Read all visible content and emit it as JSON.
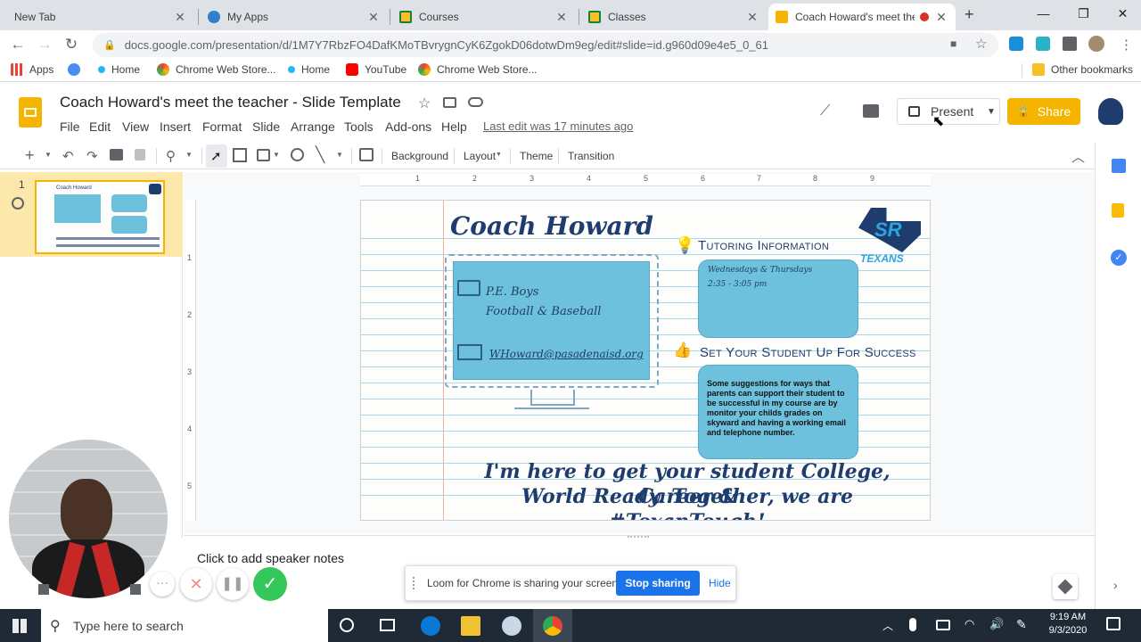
{
  "browser": {
    "tabs": [
      {
        "title": "New Tab",
        "active": false
      },
      {
        "title": "My Apps",
        "active": false
      },
      {
        "title": "Courses",
        "active": false
      },
      {
        "title": "Classes",
        "active": false
      },
      {
        "title": "Coach Howard's meet the",
        "active": true
      }
    ],
    "url": "docs.google.com/presentation/d/1M7Y7RbzFO4DafKMoTBvrygnCyK6ZgokD06dotwDm9eg/edit#slide=id.g960d09e4e5_0_61",
    "bookmarks": [
      "Apps",
      "Home",
      "Chrome Web Store...",
      "Home",
      "YouTube",
      "Chrome Web Store..."
    ],
    "other_bookmarks": "Other bookmarks"
  },
  "doc": {
    "title": "Coach Howard's meet the teacher - Slide Template",
    "menus": [
      "File",
      "Edit",
      "View",
      "Insert",
      "Format",
      "Slide",
      "Arrange",
      "Tools",
      "Add-ons",
      "Help"
    ],
    "last_edit": "Last edit was 17 minutes ago",
    "present_label": "Present",
    "share_label": "Share"
  },
  "slide_toolbar": {
    "background": "Background",
    "layout": "Layout",
    "theme": "Theme",
    "transition": "Transition"
  },
  "filmstrip": {
    "slide_number": "1"
  },
  "slide": {
    "name": "Coach Howard",
    "sport_line1": "P.E. Boys",
    "sport_line2": "Football & Baseball",
    "email": "WHoward@pasadenaisd.org",
    "tutoring_heading": "Tutoring Information",
    "tutoring_days": "Wednesdays & Thursdays",
    "tutoring_time": "2:35 - 3:05 pm",
    "success_heading": "Set Your Student Up For Success",
    "success_text": "Some suggestions for ways that parents can support their student to be successful in my course are by monitor your childs grades on skyward and having a working email and telephone number.",
    "footer_line1": "I'm here to get your student College, Career &",
    "footer_line2": "World Ready. Together, we are #TexanTough!",
    "logo_text": "SR",
    "logo_sub": "TEXANS"
  },
  "ruler": {
    "h": [
      "1",
      "2",
      "3",
      "4",
      "5",
      "6",
      "7",
      "8",
      "9"
    ],
    "v": [
      "1",
      "2",
      "3",
      "4",
      "5"
    ]
  },
  "notes_placeholder": "Click to add speaker notes",
  "loom": {
    "message": "Loom for Chrome is sharing your screen.",
    "stop": "Stop sharing",
    "hide": "Hide"
  },
  "taskbar": {
    "search_placeholder": "Type here to search",
    "time": "9:19 AM",
    "date": "9/3/2020"
  },
  "colors": {
    "accent": "#f4b400",
    "loom_blue": "#1a73e8",
    "panel": "#6ec1dd",
    "title_blue": "#1f3c6e"
  }
}
